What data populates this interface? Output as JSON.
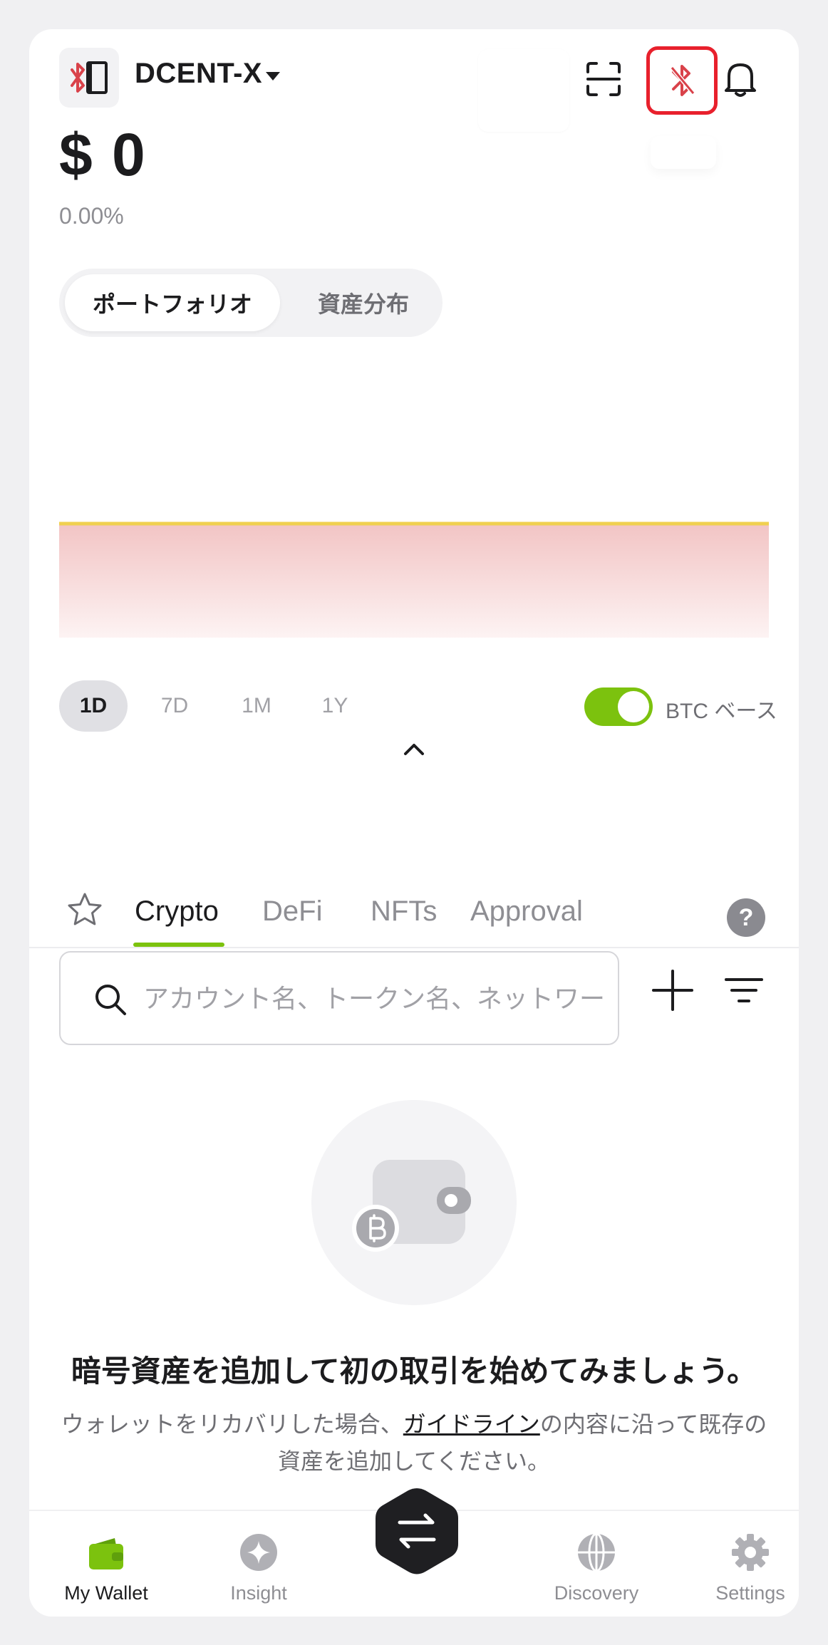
{
  "header": {
    "wallet_name": "DCENT-X",
    "balance": "$ 0",
    "change": "0.00%"
  },
  "portfolio_tabs": [
    {
      "label": "ポートフォリオ",
      "active": true
    },
    {
      "label": "資産分布",
      "active": false
    }
  ],
  "chart_ranges": [
    {
      "label": "1D",
      "active": true
    },
    {
      "label": "7D",
      "active": false
    },
    {
      "label": "1M",
      "active": false
    },
    {
      "label": "1Y",
      "active": false
    }
  ],
  "btc_base": {
    "label": "BTC ベース",
    "enabled": true
  },
  "asset_tabs": [
    {
      "label": "Crypto",
      "active": true
    },
    {
      "label": "DeFi",
      "active": false
    },
    {
      "label": "NFTs",
      "active": false
    },
    {
      "label": "Approval",
      "active": false
    }
  ],
  "help_label": "?",
  "search": {
    "placeholder": "アカウント名、トークン名、ネットワーク名",
    "value": ""
  },
  "empty_state": {
    "title": "暗号資産を追加して初の取引を始めてみましょう。",
    "desc_before": "ウォレットをリカバリした場合、",
    "desc_link": "ガイドライン",
    "desc_after": "の内容に沿って既存の資産を追加してください。"
  },
  "bottom_nav": [
    {
      "label": "My Wallet",
      "icon": "wallet-icon",
      "active": true
    },
    {
      "label": "Insight",
      "icon": "sparkle-icon",
      "active": false
    },
    {
      "label": "Discovery",
      "icon": "globe-icon",
      "active": false
    },
    {
      "label": "Settings",
      "icon": "gear-icon",
      "active": false
    }
  ],
  "colors": {
    "accent": "#7cc20e",
    "highlight": "#e8202c",
    "brand_red": "#d9424a"
  }
}
